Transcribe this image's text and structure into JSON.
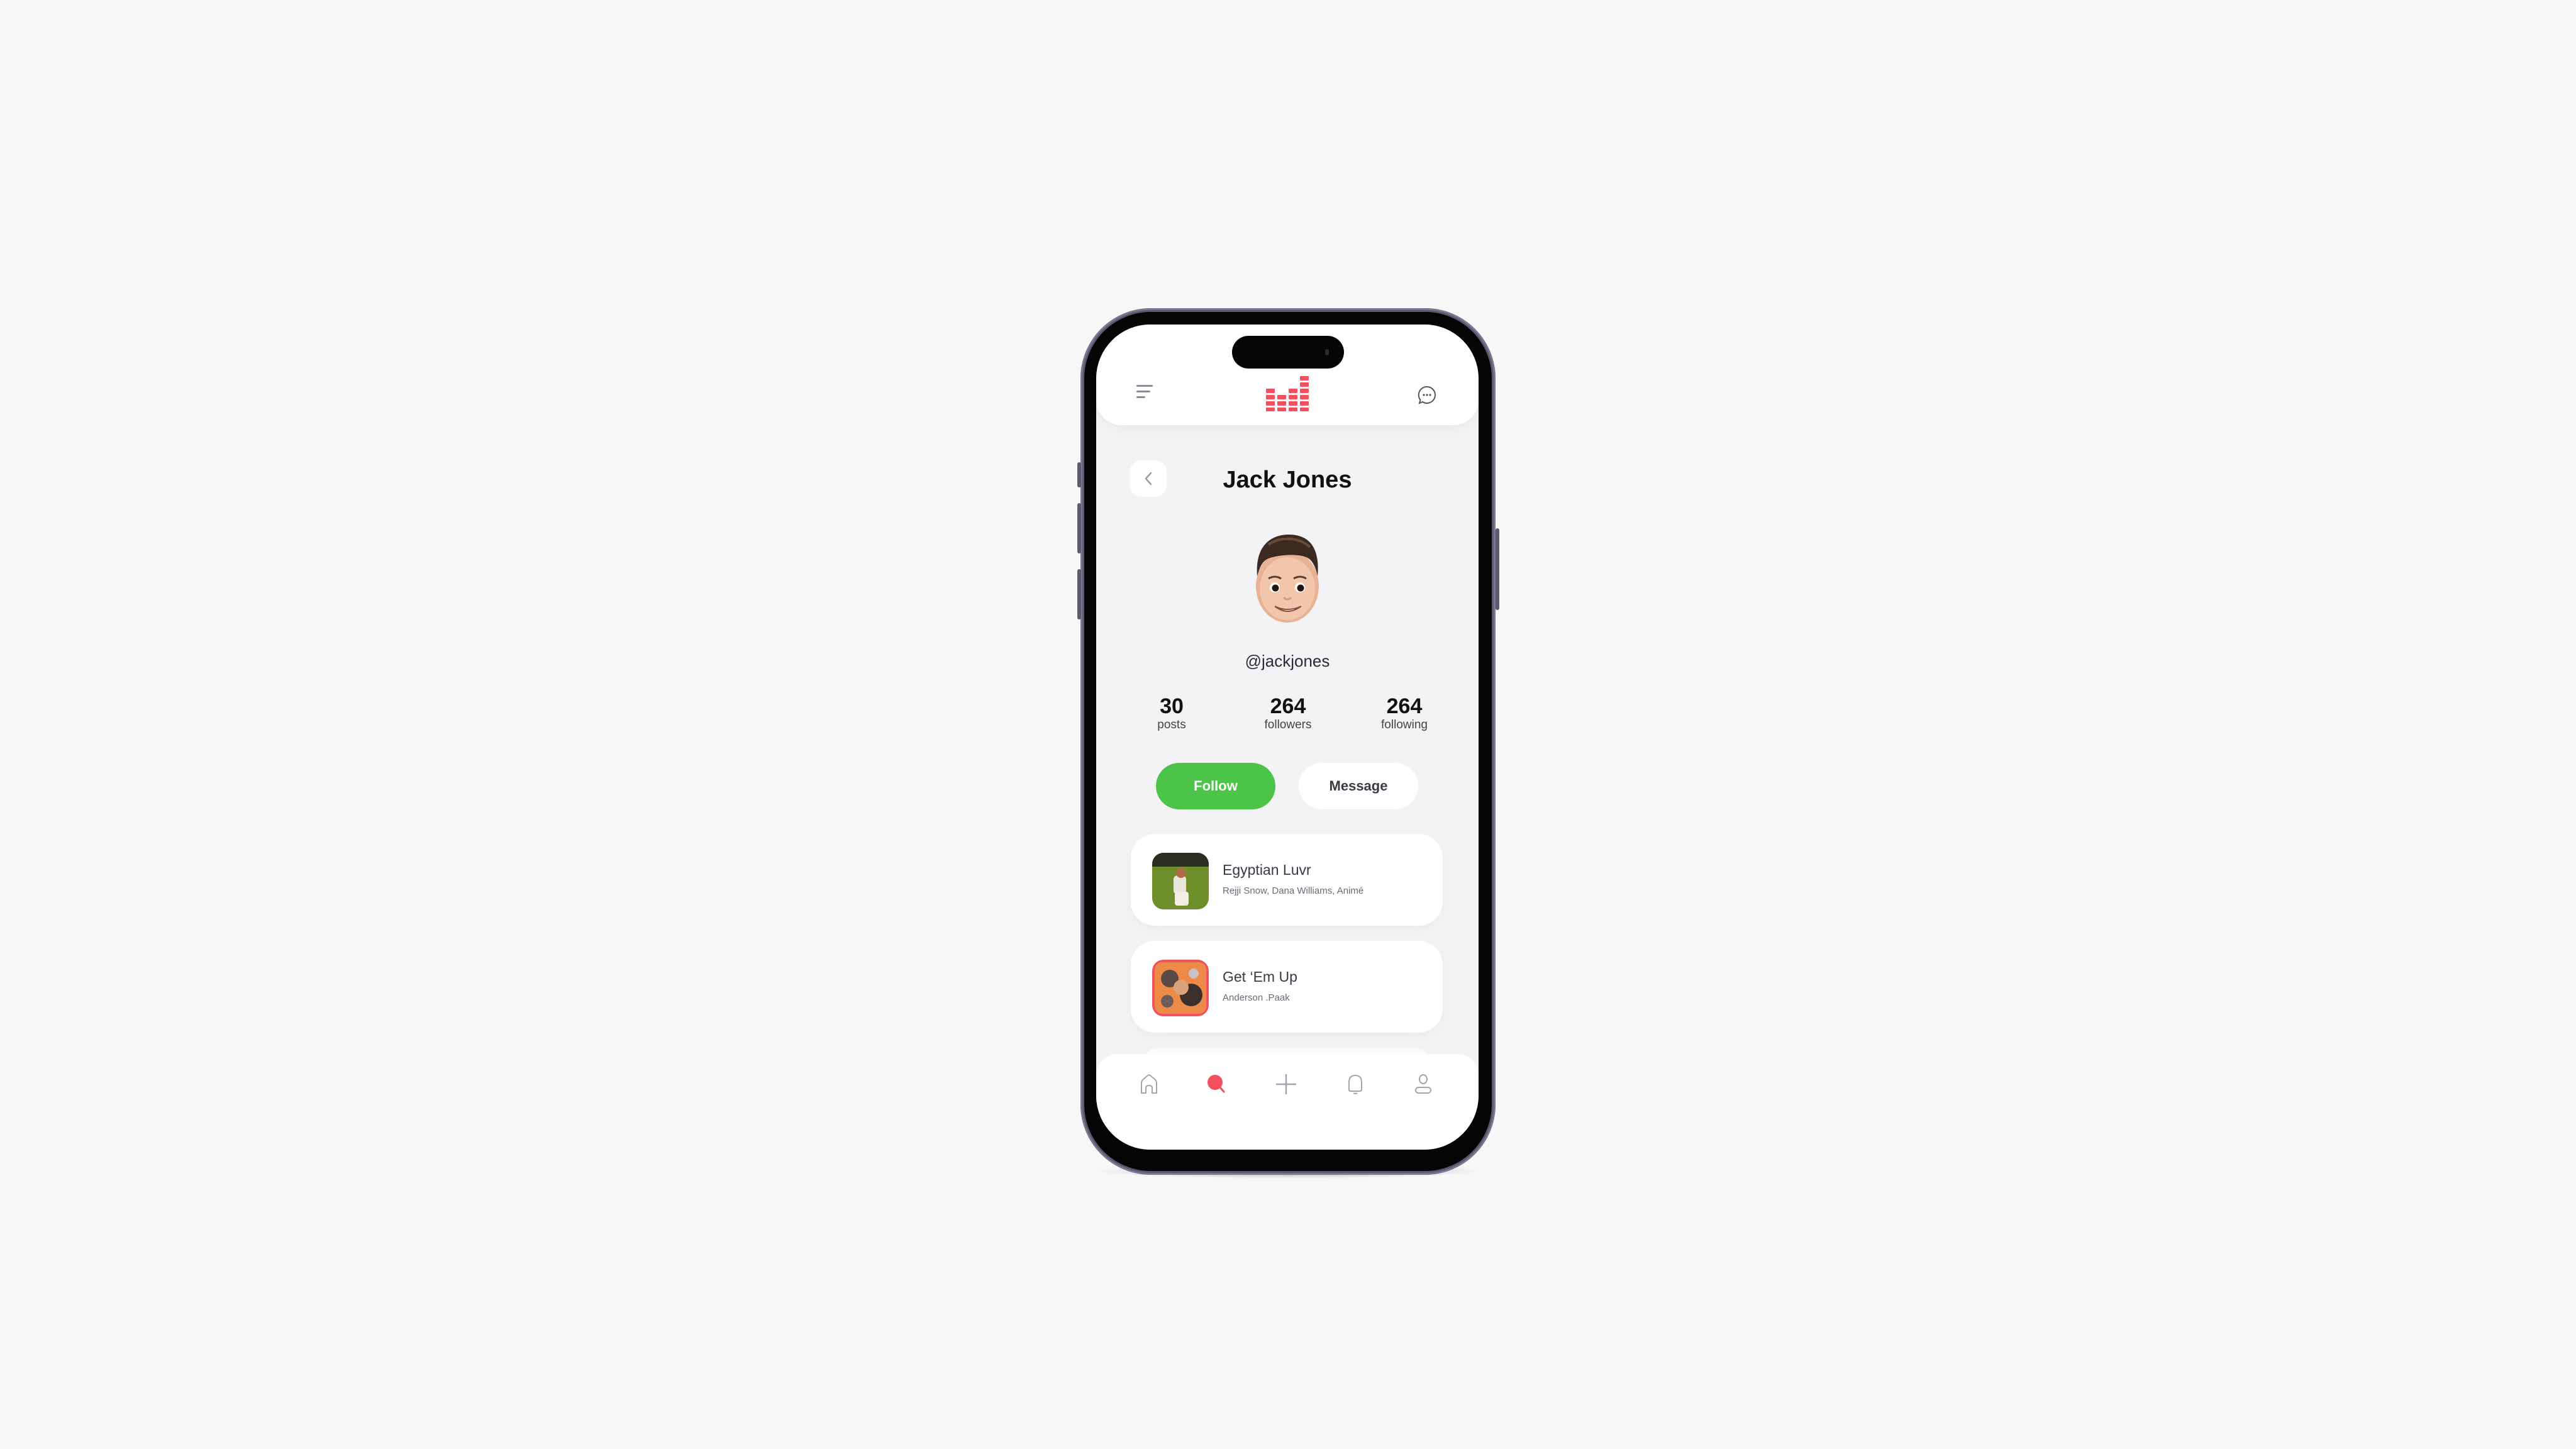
{
  "app": {
    "brand_color": "#f2505e",
    "accent_green": "#4cc44a"
  },
  "topbar": {
    "menu_icon": "menu-icon",
    "logo": "equalizer-logo",
    "chat_icon": "chat-bubble-icon"
  },
  "profile": {
    "back_icon": "chevron-left-icon",
    "name": "Jack Jones",
    "handle": "@jackjones",
    "avatar": "memoji-avatar",
    "stats": [
      {
        "value": "30",
        "label": "posts"
      },
      {
        "value": "264",
        "label": "followers"
      },
      {
        "value": "264",
        "label": "following"
      }
    ],
    "follow_label": "Follow",
    "message_label": "Message"
  },
  "tracks": [
    {
      "title": "Egyptian Luvr",
      "artists": "Rejji Snow, Dana Williams, Animé"
    },
    {
      "title": "Get ‘Em Up",
      "artists": "Anderson .Paak"
    }
  ],
  "bottom_nav": {
    "items": [
      {
        "name": "home",
        "icon": "home-icon",
        "active": false
      },
      {
        "name": "search",
        "icon": "search-icon",
        "active": true
      },
      {
        "name": "create",
        "icon": "plus-icon",
        "active": false
      },
      {
        "name": "notifications",
        "icon": "bell-icon",
        "active": false
      },
      {
        "name": "profile",
        "icon": "user-icon",
        "active": false
      }
    ]
  }
}
